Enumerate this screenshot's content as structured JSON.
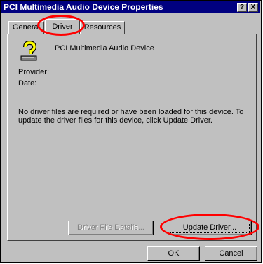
{
  "window": {
    "title": "PCI Multimedia Audio Device Properties",
    "help_label": "?",
    "close_label": "X"
  },
  "tabs": [
    {
      "label": "General"
    },
    {
      "label": "Driver",
      "selected": true
    },
    {
      "label": "Resources"
    }
  ],
  "device": {
    "name": "PCI Multimedia Audio Device",
    "icon": "unknown-device-question-icon"
  },
  "fields": {
    "provider_label": "Provider:",
    "date_label": "Date:"
  },
  "info_text": "No driver files are required or have been loaded for this device.  To update the driver files for this device, click Update Driver.",
  "buttons": {
    "driver_details": "Driver File Details...",
    "update_driver": "Update Driver...",
    "ok": "OK",
    "cancel": "Cancel"
  },
  "colors": {
    "titlebar": "#000080",
    "face": "#c0c0c0",
    "annotation": "#ff0000"
  }
}
